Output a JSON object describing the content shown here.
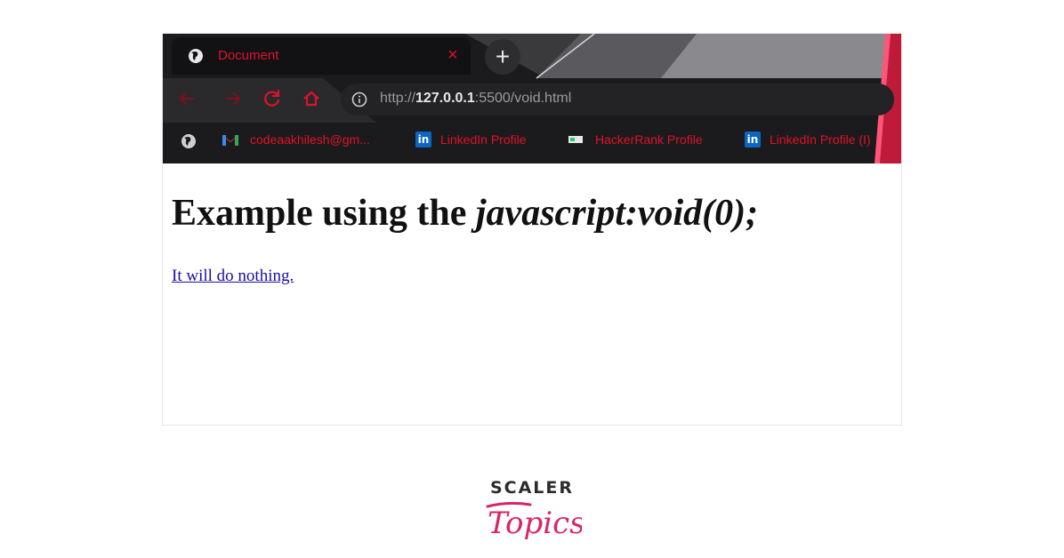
{
  "tab": {
    "title": "Document",
    "close_glyph": "×",
    "new_tab_glyph": "+"
  },
  "address_bar": {
    "scheme": "http://",
    "host": "127.0.0.1",
    "rest": ":5500/void.html"
  },
  "bookmarks": [
    {
      "icon": "gmail-icon",
      "label": "codeaakhilesh@gm..."
    },
    {
      "icon": "linkedin-icon",
      "label": "LinkedIn Profile"
    },
    {
      "icon": "hackerrank-icon",
      "label": "HackerRank Profile"
    },
    {
      "icon": "linkedin-icon",
      "label": "LinkedIn Profile (I)"
    }
  ],
  "page": {
    "heading_plain": "Example using the ",
    "heading_italic": "javascript:void(0);",
    "link_text": "It will do nothing."
  },
  "brand": {
    "name": "SCALER",
    "sub": "Topics"
  },
  "colors": {
    "accent": "#e01228",
    "link": "#1a0dab",
    "brand_pink": "#d8246b"
  }
}
